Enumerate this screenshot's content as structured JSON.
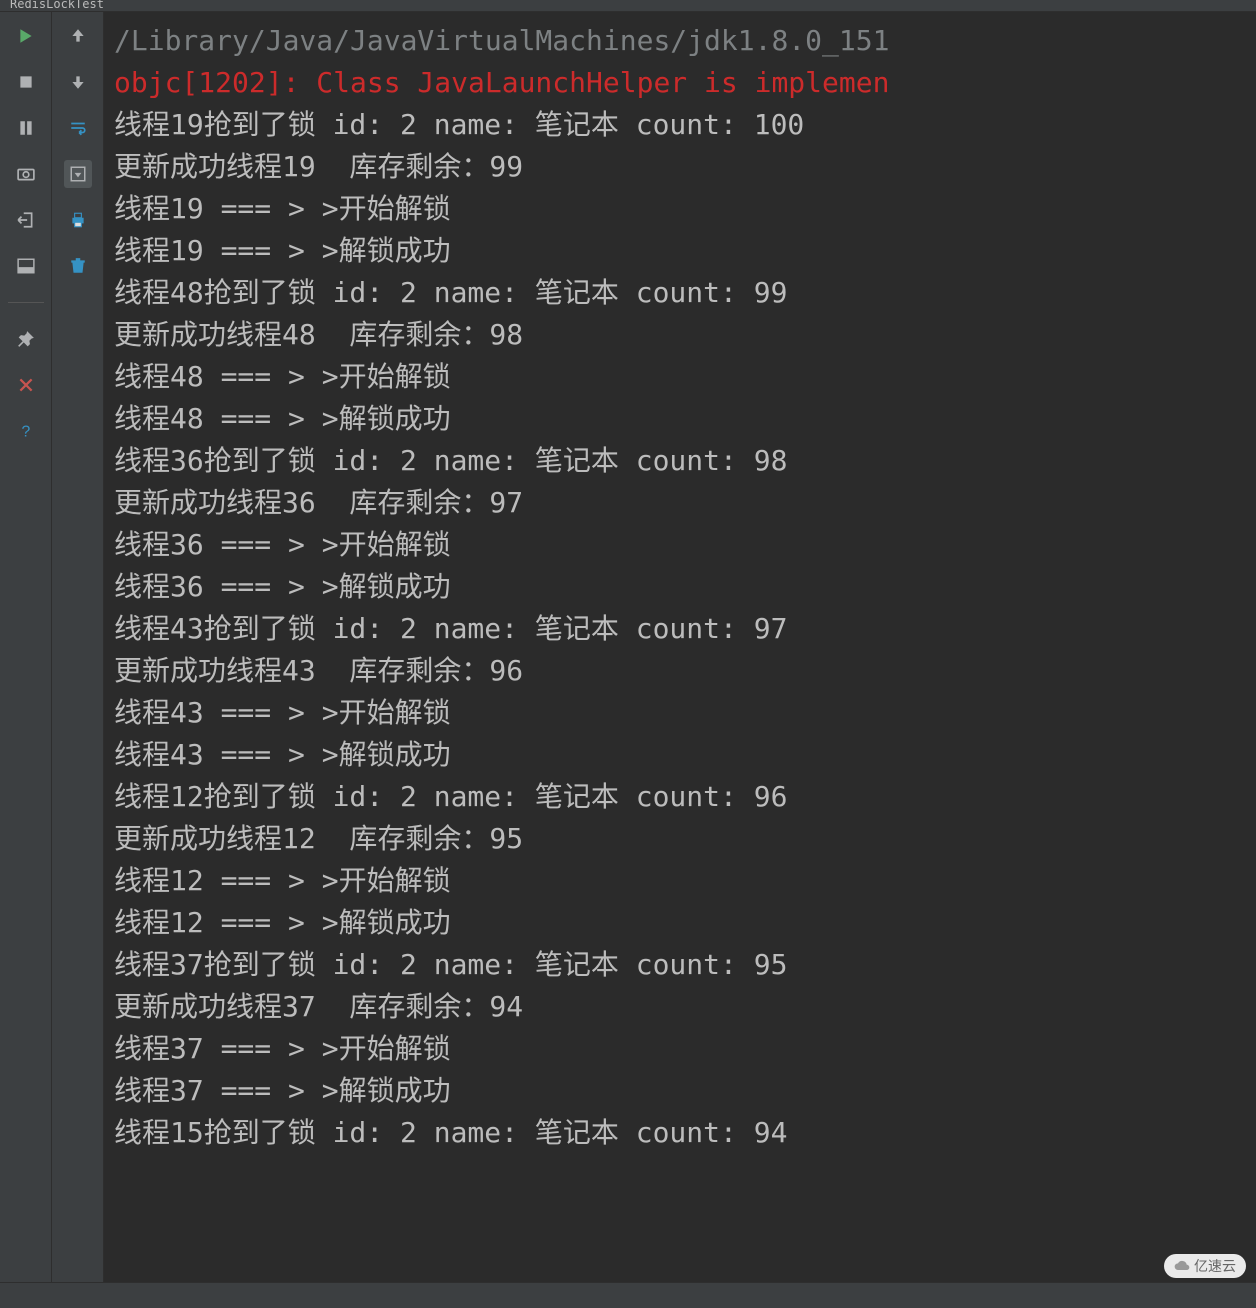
{
  "tab": {
    "title": "RedisLockTest"
  },
  "toolbar_left": {
    "run": {
      "name": "run-icon"
    },
    "stop": {
      "name": "stop-icon"
    },
    "pause": {
      "name": "pause-icon"
    },
    "camera": {
      "name": "camera-icon"
    },
    "exit": {
      "name": "exit-icon"
    },
    "layout": {
      "name": "layout-icon"
    },
    "pin": {
      "name": "pin-icon"
    },
    "close": {
      "name": "close-icon"
    },
    "help": {
      "name": "help-icon"
    }
  },
  "toolbar_right": {
    "up": {
      "name": "arrow-up-icon"
    },
    "down": {
      "name": "arrow-down-icon"
    },
    "wrap": {
      "name": "soft-wrap-icon"
    },
    "scrollend": {
      "name": "scroll-to-end-icon"
    },
    "print": {
      "name": "print-icon"
    },
    "trash": {
      "name": "trash-icon"
    }
  },
  "console": {
    "lines": [
      {
        "cls": "cmd",
        "text": "/Library/Java/JavaVirtualMachines/jdk1.8.0_151"
      },
      {
        "cls": "err",
        "text": "objc[1202]: Class JavaLaunchHelper is implemen"
      },
      {
        "cls": "",
        "text": "线程19抢到了锁 id: 2 name: 笔记本 count: 100"
      },
      {
        "cls": "",
        "text": "更新成功线程19  库存剩余：99"
      },
      {
        "cls": "",
        "text": "线程19 === > >开始解锁"
      },
      {
        "cls": "",
        "text": "线程19 === > >解锁成功"
      },
      {
        "cls": "",
        "text": "线程48抢到了锁 id: 2 name: 笔记本 count: 99"
      },
      {
        "cls": "",
        "text": "更新成功线程48  库存剩余：98"
      },
      {
        "cls": "",
        "text": "线程48 === > >开始解锁"
      },
      {
        "cls": "",
        "text": "线程48 === > >解锁成功"
      },
      {
        "cls": "",
        "text": "线程36抢到了锁 id: 2 name: 笔记本 count: 98"
      },
      {
        "cls": "",
        "text": "更新成功线程36  库存剩余：97"
      },
      {
        "cls": "",
        "text": "线程36 === > >开始解锁"
      },
      {
        "cls": "",
        "text": "线程36 === > >解锁成功"
      },
      {
        "cls": "",
        "text": "线程43抢到了锁 id: 2 name: 笔记本 count: 97"
      },
      {
        "cls": "",
        "text": "更新成功线程43  库存剩余：96"
      },
      {
        "cls": "",
        "text": "线程43 === > >开始解锁"
      },
      {
        "cls": "",
        "text": "线程43 === > >解锁成功"
      },
      {
        "cls": "",
        "text": "线程12抢到了锁 id: 2 name: 笔记本 count: 96"
      },
      {
        "cls": "",
        "text": "更新成功线程12  库存剩余：95"
      },
      {
        "cls": "",
        "text": "线程12 === > >开始解锁"
      },
      {
        "cls": "",
        "text": "线程12 === > >解锁成功"
      },
      {
        "cls": "",
        "text": "线程37抢到了锁 id: 2 name: 笔记本 count: 95"
      },
      {
        "cls": "",
        "text": "更新成功线程37  库存剩余：94"
      },
      {
        "cls": "",
        "text": "线程37 === > >开始解锁"
      },
      {
        "cls": "",
        "text": "线程37 === > >解锁成功"
      },
      {
        "cls": "",
        "text": "线程15抢到了锁 id: 2 name: 笔记本 count: 94"
      }
    ]
  },
  "watermark": {
    "text": "亿速云"
  }
}
